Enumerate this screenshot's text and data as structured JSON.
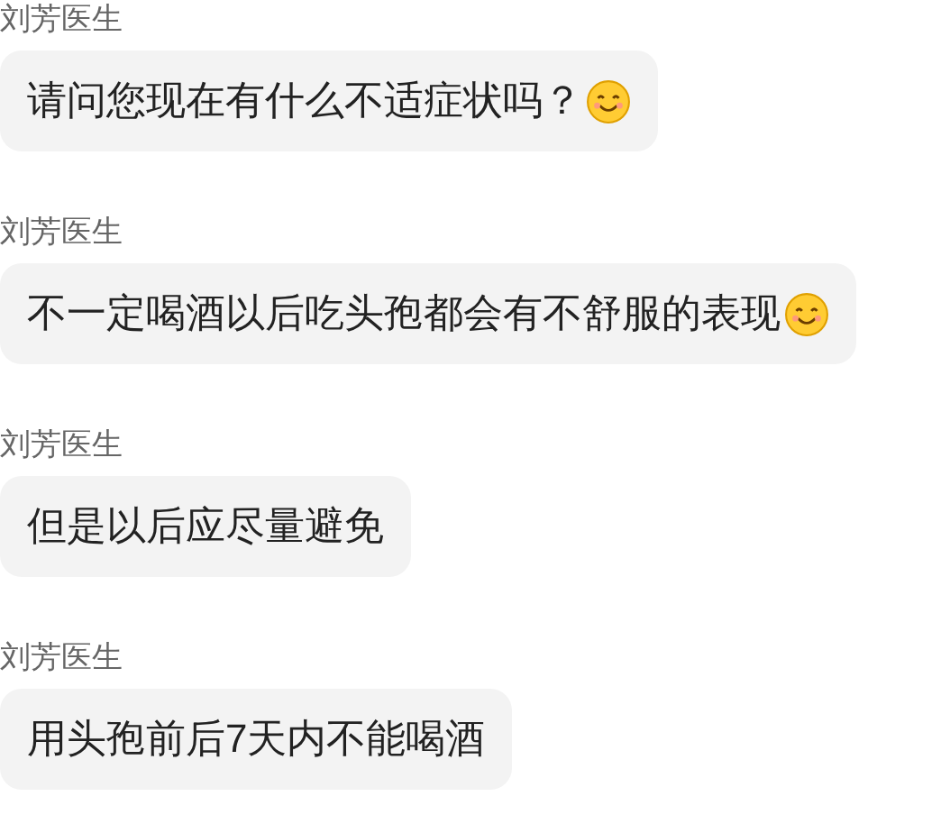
{
  "messages": [
    {
      "sender": "刘芳医生",
      "text": "请问您现在有什么不适症状吗？",
      "smiley": true
    },
    {
      "sender": "刘芳医生",
      "text": "不一定喝酒以后吃头孢都会有不舒服的表现",
      "smiley": true
    },
    {
      "sender": "刘芳医生",
      "text": "但是以后应尽量避免",
      "smiley": false
    },
    {
      "sender": "刘芳医生",
      "text": "用头孢前后7天内不能喝酒",
      "smiley": false
    }
  ]
}
